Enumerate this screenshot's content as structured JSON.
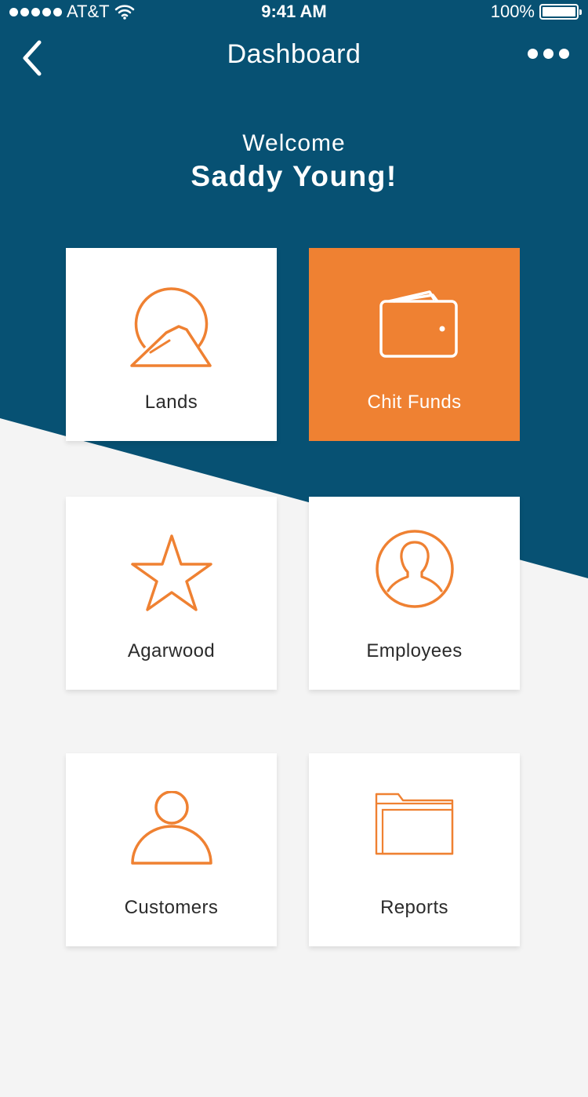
{
  "status_bar": {
    "carrier": "AT&T",
    "time": "9:41 AM",
    "battery_label": "100%",
    "battery_level": 1.0
  },
  "nav": {
    "title": "Dashboard",
    "back_icon": "chevron-left-icon",
    "more_icon": "more-horizontal-icon"
  },
  "welcome": {
    "greeting": "Welcome",
    "name": "Saddy Young!"
  },
  "colors": {
    "header_blue": "#075173",
    "accent_orange": "#ef8132",
    "background": "#f4f4f4"
  },
  "tiles": [
    {
      "label": "Lands",
      "icon": "landscape-icon",
      "selected": false
    },
    {
      "label": "Chit Funds",
      "icon": "wallet-icon",
      "selected": true
    },
    {
      "label": "Agarwood",
      "icon": "star-icon",
      "selected": false
    },
    {
      "label": "Employees",
      "icon": "employee-icon",
      "selected": false
    },
    {
      "label": "Customers",
      "icon": "customer-icon",
      "selected": false
    },
    {
      "label": "Reports",
      "icon": "folder-icon",
      "selected": false
    }
  ]
}
